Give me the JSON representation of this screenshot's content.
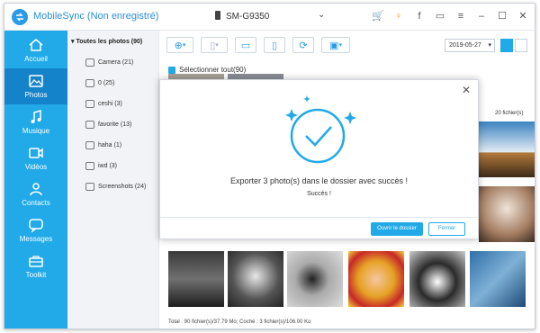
{
  "app": {
    "title": "MobileSync (Non enregistré)",
    "device": "SM-G9350"
  },
  "nav": [
    {
      "label": "Accueil",
      "icon": "home-icon"
    },
    {
      "label": "Photos",
      "icon": "photo-icon"
    },
    {
      "label": "Musique",
      "icon": "music-icon"
    },
    {
      "label": "Vidéos",
      "icon": "video-icon"
    },
    {
      "label": "Contacts",
      "icon": "contacts-icon"
    },
    {
      "label": "Messages",
      "icon": "messages-icon"
    },
    {
      "label": "Toolkit",
      "icon": "toolkit-icon"
    }
  ],
  "tree": {
    "head": "Toutes les photos (90)",
    "items": [
      "Camera (21)",
      "0 (25)",
      "ceshi (3)",
      "favorite (13)",
      "haha (1)",
      "iwd (3)",
      "Screenshots (24)"
    ]
  },
  "toolbar": {
    "date": "2019-05-27"
  },
  "list": {
    "select_all": "Sélectionner tout(90)",
    "count": "20 fichier(s)"
  },
  "status": "Total : 90 fichier(s)/37.79 Mo; Coché : 3 fichier(s)/106.00 Ko",
  "dialog": {
    "message": "Exporter 3 photo(s) dans le dossier avec succès !",
    "sub": "Succès !",
    "open_label": "Ouvrir le dossier",
    "close_label": "Fermer"
  },
  "colors": {
    "accent": "#21a9e8",
    "accent_dark": "#1583c9"
  }
}
